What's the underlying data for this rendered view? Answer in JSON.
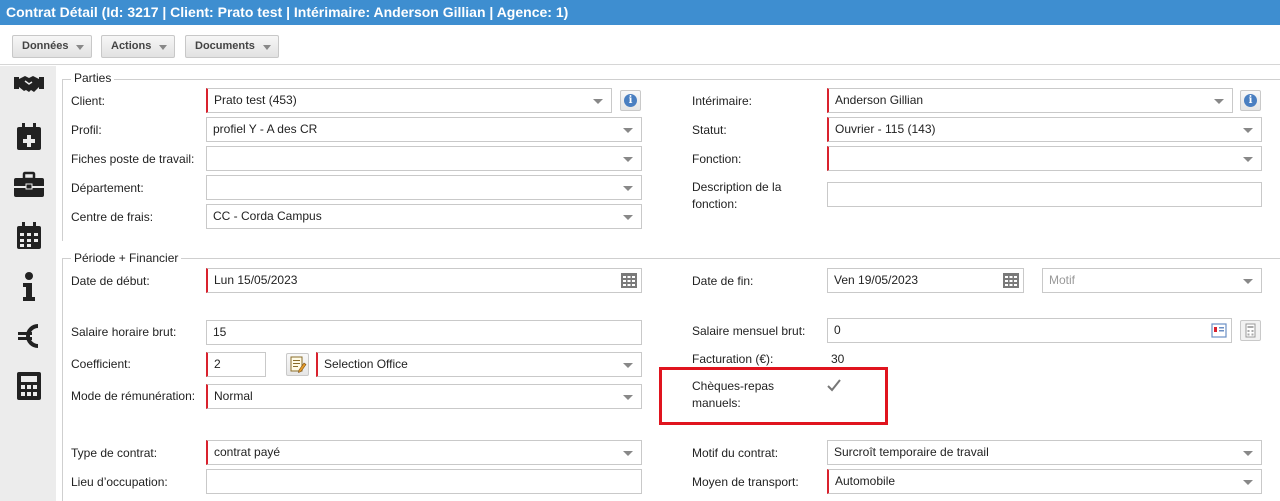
{
  "window": {
    "title": "Contrat Détail (Id: 3217 | Client: Prato test | Intérimaire: Anderson Gillian | Agence: 1)"
  },
  "toolbar": {
    "donnees": "Données",
    "actions": "Actions",
    "documents": "Documents"
  },
  "sidebar": {
    "icons": [
      "handshake-icon",
      "calendar-plus-icon",
      "briefcase-icon",
      "calendar-icon",
      "info-icon",
      "euro-icon",
      "calculator-icon"
    ]
  },
  "parties": {
    "legend": "Parties",
    "client": {
      "label": "Client:",
      "value": "Prato test (453)"
    },
    "profil": {
      "label": "Profil:",
      "value": "profiel Y - A des CR"
    },
    "fiches": {
      "label": "Fiches poste de travail:",
      "value": ""
    },
    "departement": {
      "label": "Département:",
      "value": ""
    },
    "centre": {
      "label": "Centre de frais:",
      "value": "CC - Corda Campus"
    },
    "interimaire": {
      "label": "Intérimaire:",
      "value": "Anderson Gillian"
    },
    "statut": {
      "label": "Statut:",
      "value": "Ouvrier - 115 (143)"
    },
    "fonction": {
      "label": "Fonction:",
      "value": ""
    },
    "description": {
      "label_line1": "Description de la",
      "label_line2": "fonction:",
      "value": ""
    }
  },
  "periode": {
    "legend": "Période + Financier",
    "date_debut": {
      "label": "Date de début:",
      "value": "Lun 15/05/2023"
    },
    "date_fin": {
      "label": "Date de fin:",
      "value": "Ven 19/05/2023"
    },
    "motif": {
      "placeholder": "Motif"
    },
    "salaire_horaire": {
      "label": "Salaire horaire brut:",
      "value": "15"
    },
    "salaire_mensuel": {
      "label": "Salaire mensuel brut:",
      "value": "0"
    },
    "coefficient": {
      "label": "Coefficient:",
      "value": "2",
      "option": "Selection Office"
    },
    "facturation": {
      "label": "Facturation (€):",
      "value": "30"
    },
    "cheques": {
      "label_line1": "Chèques-repas",
      "label_line2": "manuels:",
      "checked": true
    },
    "mode": {
      "label": "Mode de rémunération:",
      "value": "Normal"
    },
    "type_contrat": {
      "label": "Type de contrat:",
      "value": "contrat payé"
    },
    "motif_contrat": {
      "label": "Motif du contrat:",
      "value": "Surcroît temporaire de travail"
    },
    "lieu": {
      "label": "Lieu d’occupation:",
      "value": ""
    },
    "transport": {
      "label": "Moyen de transport:",
      "value": "Automobile"
    }
  },
  "colors": {
    "titlebar": "#3e8ed0",
    "required": "#d9212d",
    "highlight": "#e0141e"
  }
}
